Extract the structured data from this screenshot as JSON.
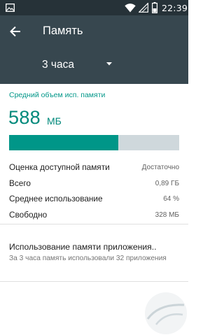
{
  "status_bar": {
    "time": "22:39",
    "icons": [
      "gallery-icon",
      "wifi-icon",
      "signal-icon",
      "battery-icon"
    ]
  },
  "app_bar": {
    "title": "Память",
    "back_icon": "arrow-back-icon"
  },
  "period_selector": {
    "selected": "3 часа",
    "caret_icon": "dropdown-caret-icon"
  },
  "summary": {
    "section_title": "Средний объем исп. памяти",
    "value": "588",
    "unit": "МБ",
    "usage_fraction": 0.64
  },
  "stats": [
    {
      "label": "Оценка доступной памяти",
      "value": "Достаточно"
    },
    {
      "label": "Всего",
      "value": "0,89 ГБ"
    },
    {
      "label": "Среднее использование",
      "value": "64 %"
    },
    {
      "label": "Свободно",
      "value": "328 МБ"
    }
  ],
  "app_usage": {
    "heading": "Использование памяти приложения..",
    "description": "За 3 часа память использовали 32 приложения"
  },
  "colors": {
    "status_bar": "#263238",
    "app_bar": "#37474f",
    "accent": "#009688",
    "bar_track": "#cfd8dc"
  }
}
